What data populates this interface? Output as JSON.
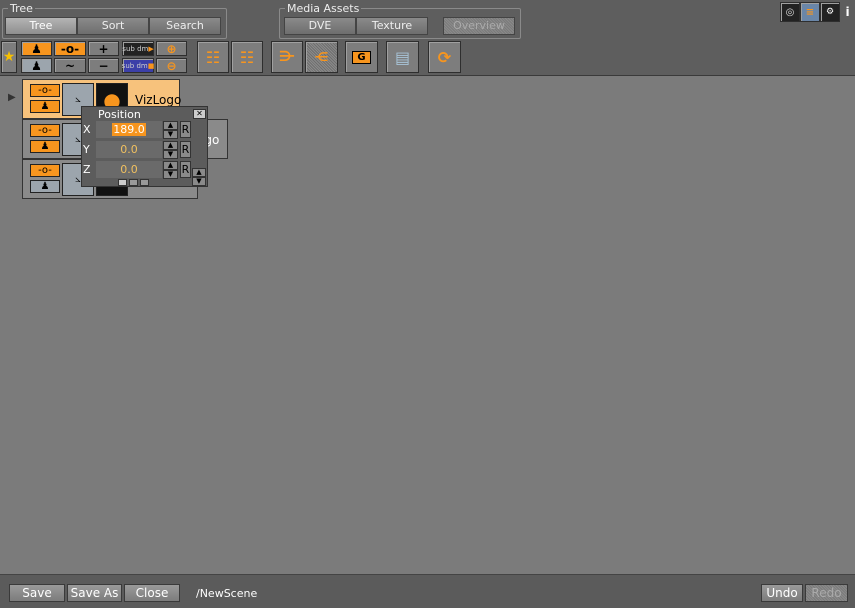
{
  "tree_group": {
    "label": "Tree",
    "tabs": [
      "Tree",
      "Sort",
      "Search"
    ],
    "active": "Tree"
  },
  "media_group": {
    "label": "Media Assets",
    "tabs": [
      "DVE",
      "Texture",
      "Overview"
    ]
  },
  "toolbar": {
    "sub_label": "sub",
    "dm_label": "dm",
    "ch_label": "G"
  },
  "nodes": [
    {
      "label": "VizLogo",
      "selected": true
    },
    {
      "label": "VizLogo"
    },
    {
      "label": ""
    }
  ],
  "position_panel": {
    "title": "Position",
    "x_label": "X",
    "y_label": "Y",
    "z_label": "Z",
    "x": "189.0",
    "y": "0.0",
    "z": "0.0",
    "reset": "R"
  },
  "bottom": {
    "save": "Save",
    "save_as": "Save As",
    "close": "Close",
    "path": "/NewScene",
    "undo": "Undo",
    "redo": "Redo"
  },
  "colors": {
    "accent": "#f7951e",
    "background": "#7b7b7b"
  }
}
